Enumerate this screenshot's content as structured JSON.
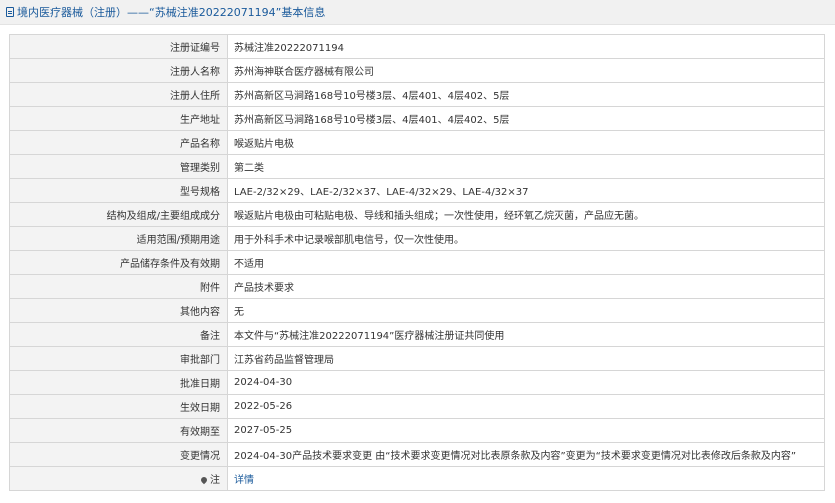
{
  "header": {
    "title": "境内医疗器械（注册）——“苏械注准20222071194”基本信息",
    "icon": "document-icon"
  },
  "rows": [
    {
      "label": "注册证编号",
      "value": "苏械注准20222071194"
    },
    {
      "label": "注册人名称",
      "value": "苏州海神联合医疗器械有限公司"
    },
    {
      "label": "注册人住所",
      "value": "苏州高新区马涧路168号10号楼3层、4层401、4层402、5层"
    },
    {
      "label": "生产地址",
      "value": "苏州高新区马涧路168号10号楼3层、4层401、4层402、5层"
    },
    {
      "label": "产品名称",
      "value": "喉返贴片电极"
    },
    {
      "label": "管理类别",
      "value": "第二类"
    },
    {
      "label": "型号规格",
      "value": "LAE-2/32×29、LAE-2/32×37、LAE-4/32×29、LAE-4/32×37"
    },
    {
      "label": "结构及组成/主要组成成分",
      "value": "喉返贴片电极由可粘贴电极、导线和插头组成；一次性使用，经环氧乙烷灭菌，产品应无菌。"
    },
    {
      "label": "适用范围/预期用途",
      "value": "用于外科手术中记录喉部肌电信号，仅一次性使用。"
    },
    {
      "label": "产品储存条件及有效期",
      "value": "不适用"
    },
    {
      "label": "附件",
      "value": "产品技术要求"
    },
    {
      "label": "其他内容",
      "value": "无"
    },
    {
      "label": "备注",
      "value": "本文件与“苏械注准20222071194”医疗器械注册证共同使用"
    },
    {
      "label": "审批部门",
      "value": "江苏省药品监督管理局"
    },
    {
      "label": "批准日期",
      "value": "2024-04-30"
    },
    {
      "label": "生效日期",
      "value": "2022-05-26"
    },
    {
      "label": "有效期至",
      "value": "2027-05-25"
    },
    {
      "label": "变更情况",
      "value": "2024-04-30产品技术要求变更 由“技术要求变更情况对比表原条款及内容”变更为“技术要求变更情况对比表修改后条款及内容”"
    }
  ],
  "note_row": {
    "label": "注",
    "link": "详情",
    "icon": "map-pin-icon"
  }
}
